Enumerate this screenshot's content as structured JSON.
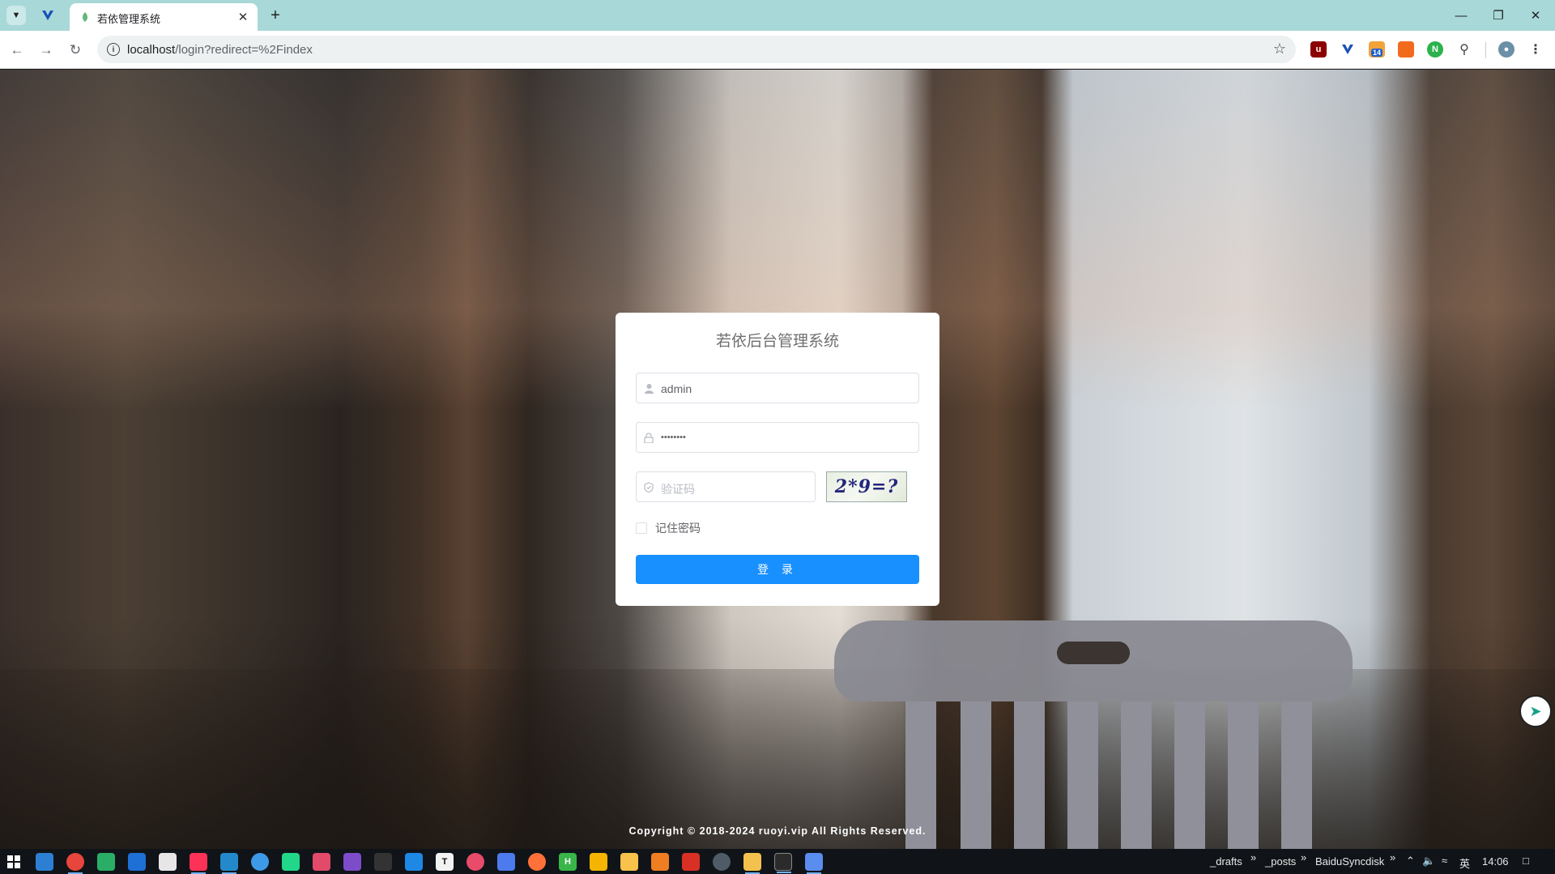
{
  "browser": {
    "tab_title": "若依管理系统",
    "url_host": "localhost",
    "url_path": "/login?redirect=%2Findex",
    "extension_badge": "14"
  },
  "login": {
    "title": "若依后台管理系统",
    "username_value": "admin",
    "password_value": "••••••••",
    "captcha_placeholder": "验证码",
    "captcha_text": "2*9=?",
    "remember_label": "记住密码",
    "login_button": "登 录"
  },
  "footer": {
    "copyright": "Copyright © 2018-2024 ruoyi.vip All Rights Reserved."
  },
  "taskbar": {
    "folder_1": "_drafts",
    "folder_2": "_posts",
    "folder_3": "BaiduSyncdisk",
    "ime": "英",
    "time": "14:06"
  },
  "colors": {
    "primary_button": "#1890ff",
    "tab_strip": "#a8d8d8"
  }
}
